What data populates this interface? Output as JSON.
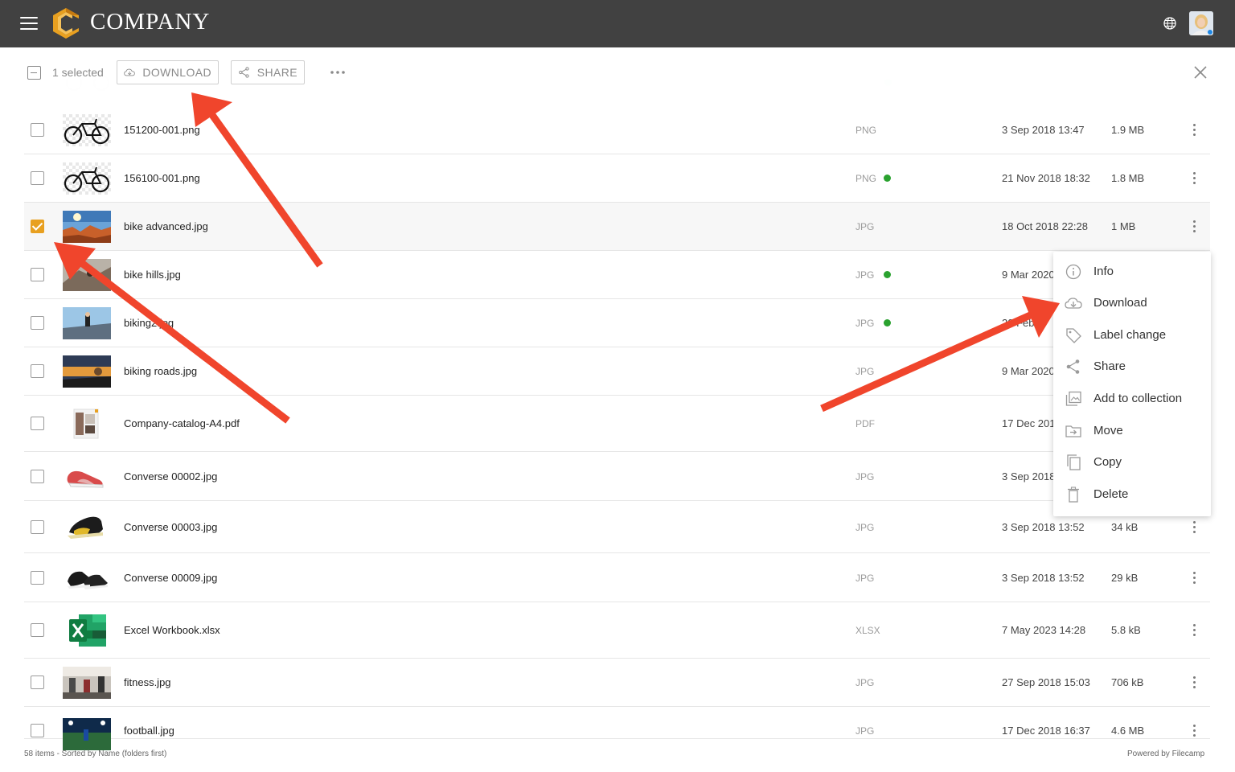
{
  "header": {
    "brand": "COMPANY",
    "accent_color": "#e8a020",
    "bar_color": "#414141"
  },
  "toolbar": {
    "selected_label": "1 selected",
    "download_label": "DOWNLOAD",
    "share_label": "SHARE"
  },
  "files": [
    {
      "name": "151200-001.png",
      "type": "PNG",
      "date": "3 Sep 2018 13:47",
      "size": "1.9 MB",
      "dot": false,
      "checked": false,
      "thumb": "bike-black"
    },
    {
      "name": "156100-001.png",
      "type": "PNG",
      "date": "21 Nov 2018 18:32",
      "size": "1.8 MB",
      "dot": true,
      "checked": false,
      "thumb": "bike-black"
    },
    {
      "name": "bike advanced.jpg",
      "type": "JPG",
      "date": "18 Oct 2018 22:28",
      "size": "1 MB",
      "dot": false,
      "checked": true,
      "thumb": "canyon"
    },
    {
      "name": "bike hills.jpg",
      "type": "JPG",
      "date": "9 Mar 2020",
      "size": "",
      "dot": true,
      "checked": false,
      "thumb": "hills"
    },
    {
      "name": "biking2.jpg",
      "type": "JPG",
      "date": "20 Feb 2",
      "size": "",
      "dot": true,
      "checked": false,
      "thumb": "road-blue"
    },
    {
      "name": "biking roads.jpg",
      "type": "JPG",
      "date": "9 Mar 2020",
      "size": "",
      "dot": false,
      "checked": false,
      "thumb": "sunset"
    },
    {
      "name": "Company-catalog-A4.pdf",
      "type": "PDF",
      "date": "17 Dec 201",
      "size": "",
      "dot": false,
      "checked": false,
      "thumb": "pdf"
    },
    {
      "name": "Converse 00002.jpg",
      "type": "JPG",
      "date": "3 Sep 2018",
      "size": "",
      "dot": false,
      "checked": false,
      "thumb": "shoe-red"
    },
    {
      "name": "Converse 00003.jpg",
      "type": "JPG",
      "date": "3 Sep 2018 13:52",
      "size": "34 kB",
      "dot": false,
      "checked": false,
      "thumb": "shoe-yellow"
    },
    {
      "name": "Converse 00009.jpg",
      "type": "JPG",
      "date": "3 Sep 2018 13:52",
      "size": "29 kB",
      "dot": false,
      "checked": false,
      "thumb": "shoe-black"
    },
    {
      "name": "Excel Workbook.xlsx",
      "type": "XLSX",
      "date": "7 May 2023 14:28",
      "size": "5.8 kB",
      "dot": false,
      "checked": false,
      "thumb": "excel"
    },
    {
      "name": "fitness.jpg",
      "type": "JPG",
      "date": "27 Sep 2018 15:03",
      "size": "706 kB",
      "dot": false,
      "checked": false,
      "thumb": "fitness"
    },
    {
      "name": "football.jpg",
      "type": "JPG",
      "date": "17 Dec 2018 16:37",
      "size": "4.6 MB",
      "dot": false,
      "checked": false,
      "thumb": "stadium"
    }
  ],
  "context_menu": {
    "items": [
      "Info",
      "Download",
      "Label change",
      "Share",
      "Add to collection",
      "Move",
      "Copy",
      "Delete"
    ]
  },
  "footer": {
    "status": "58 items - Sorted by Name (folders first)",
    "powered_by": "Powered by Filecamp"
  },
  "colors": {
    "annotation_arrow": "#f0452c",
    "status_dot": "#2aa22f"
  }
}
